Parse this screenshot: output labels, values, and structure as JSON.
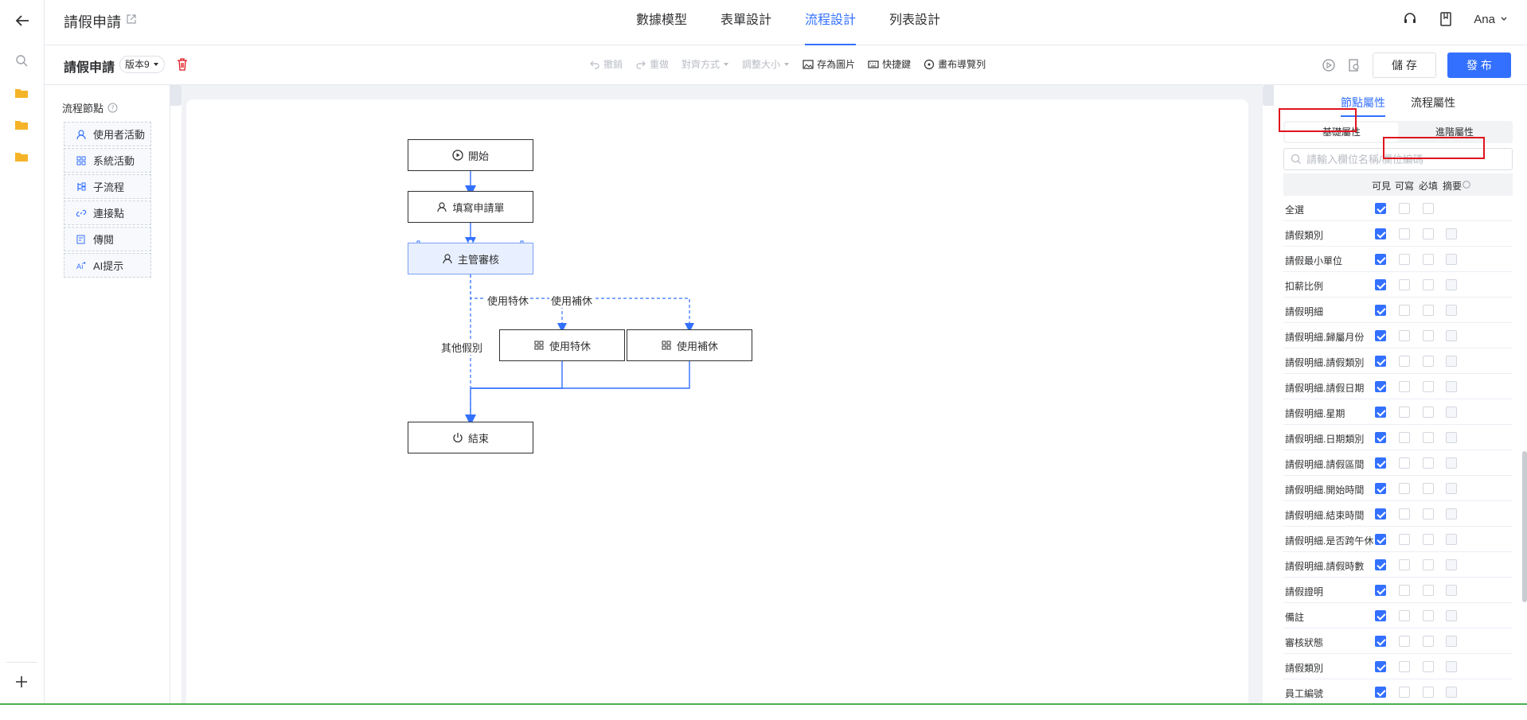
{
  "header": {
    "app_title": "請假申請",
    "nav_tabs": [
      {
        "label": "數據模型"
      },
      {
        "label": "表單設計"
      },
      {
        "label": "流程設計"
      },
      {
        "label": "列表設計"
      }
    ],
    "active_tab": "流程設計",
    "user_name": "Ana"
  },
  "toolbar": {
    "process_name": "請假申請",
    "version": "版本9",
    "tools": [
      {
        "label": "撤銷",
        "disabled": true,
        "icon": "undo-icon"
      },
      {
        "label": "重做",
        "disabled": true,
        "icon": "redo-icon"
      },
      {
        "label": "對齊方式",
        "disabled": true,
        "icon": ""
      },
      {
        "label": "調整大小",
        "disabled": true,
        "icon": ""
      },
      {
        "label": "存為圖片",
        "disabled": false,
        "icon": "image-icon"
      },
      {
        "label": "快捷鍵",
        "disabled": false,
        "icon": "keyboard-icon"
      },
      {
        "label": "畫布導覽列",
        "disabled": false,
        "icon": "compass-icon"
      }
    ],
    "save_label": "儲 存",
    "publish_label": "發 布"
  },
  "node_panel": {
    "title": "流程節點",
    "items": [
      {
        "label": "使用者活動",
        "icon": "user-icon"
      },
      {
        "label": "系統活動",
        "icon": "grid-icon"
      },
      {
        "label": "子流程",
        "icon": "subflow-icon"
      },
      {
        "label": "連接點",
        "icon": "link-icon"
      },
      {
        "label": "傳閱",
        "icon": "circulate-icon"
      },
      {
        "label": "AI提示",
        "icon": "ai-icon"
      }
    ]
  },
  "flow": {
    "nodes": {
      "start": "開始",
      "fill": "填寫申請單",
      "review": "主管審核",
      "special": "使用特休",
      "comp": "使用補休",
      "end": "結束"
    },
    "edges": {
      "special": "使用特休",
      "comp": "使用補休",
      "other": "其他假別"
    }
  },
  "right_panel": {
    "tabs": [
      {
        "label": "節點屬性"
      },
      {
        "label": "流程屬性"
      }
    ],
    "active_tab": "節點屬性",
    "segments": [
      {
        "label": "基礎屬性"
      },
      {
        "label": "進階屬性"
      }
    ],
    "search_placeholder": "請輸入欄位名稱/欄位編碼",
    "columns": [
      "可見",
      "可寫",
      "必填",
      "摘要"
    ],
    "fields": [
      {
        "name": "全選",
        "visible": true
      },
      {
        "name": "請假類別",
        "visible": true
      },
      {
        "name": "請假最小單位",
        "visible": true
      },
      {
        "name": "扣薪比例",
        "visible": true
      },
      {
        "name": "請假明細",
        "visible": true
      },
      {
        "name": "請假明細.歸屬月份",
        "visible": true
      },
      {
        "name": "請假明細.請假類別",
        "visible": true
      },
      {
        "name": "請假明細.請假日期",
        "visible": true
      },
      {
        "name": "請假明細.星期",
        "visible": true
      },
      {
        "name": "請假明細.日期類別",
        "visible": true
      },
      {
        "name": "請假明細.請假區間",
        "visible": true
      },
      {
        "name": "請假明細.開始時間",
        "visible": true
      },
      {
        "name": "請假明細.結束時間",
        "visible": true
      },
      {
        "name": "請假明細.是否跨午休",
        "visible": true
      },
      {
        "name": "請假明細.請假時數",
        "visible": true
      },
      {
        "name": "請假證明",
        "visible": true
      },
      {
        "name": "備註",
        "visible": true
      },
      {
        "name": "審核狀態",
        "visible": true
      },
      {
        "name": "請假類別",
        "visible": true
      },
      {
        "name": "員工編號",
        "visible": true
      }
    ]
  },
  "colors": {
    "accent": "#3370ff",
    "highlight": "#e0141e"
  }
}
